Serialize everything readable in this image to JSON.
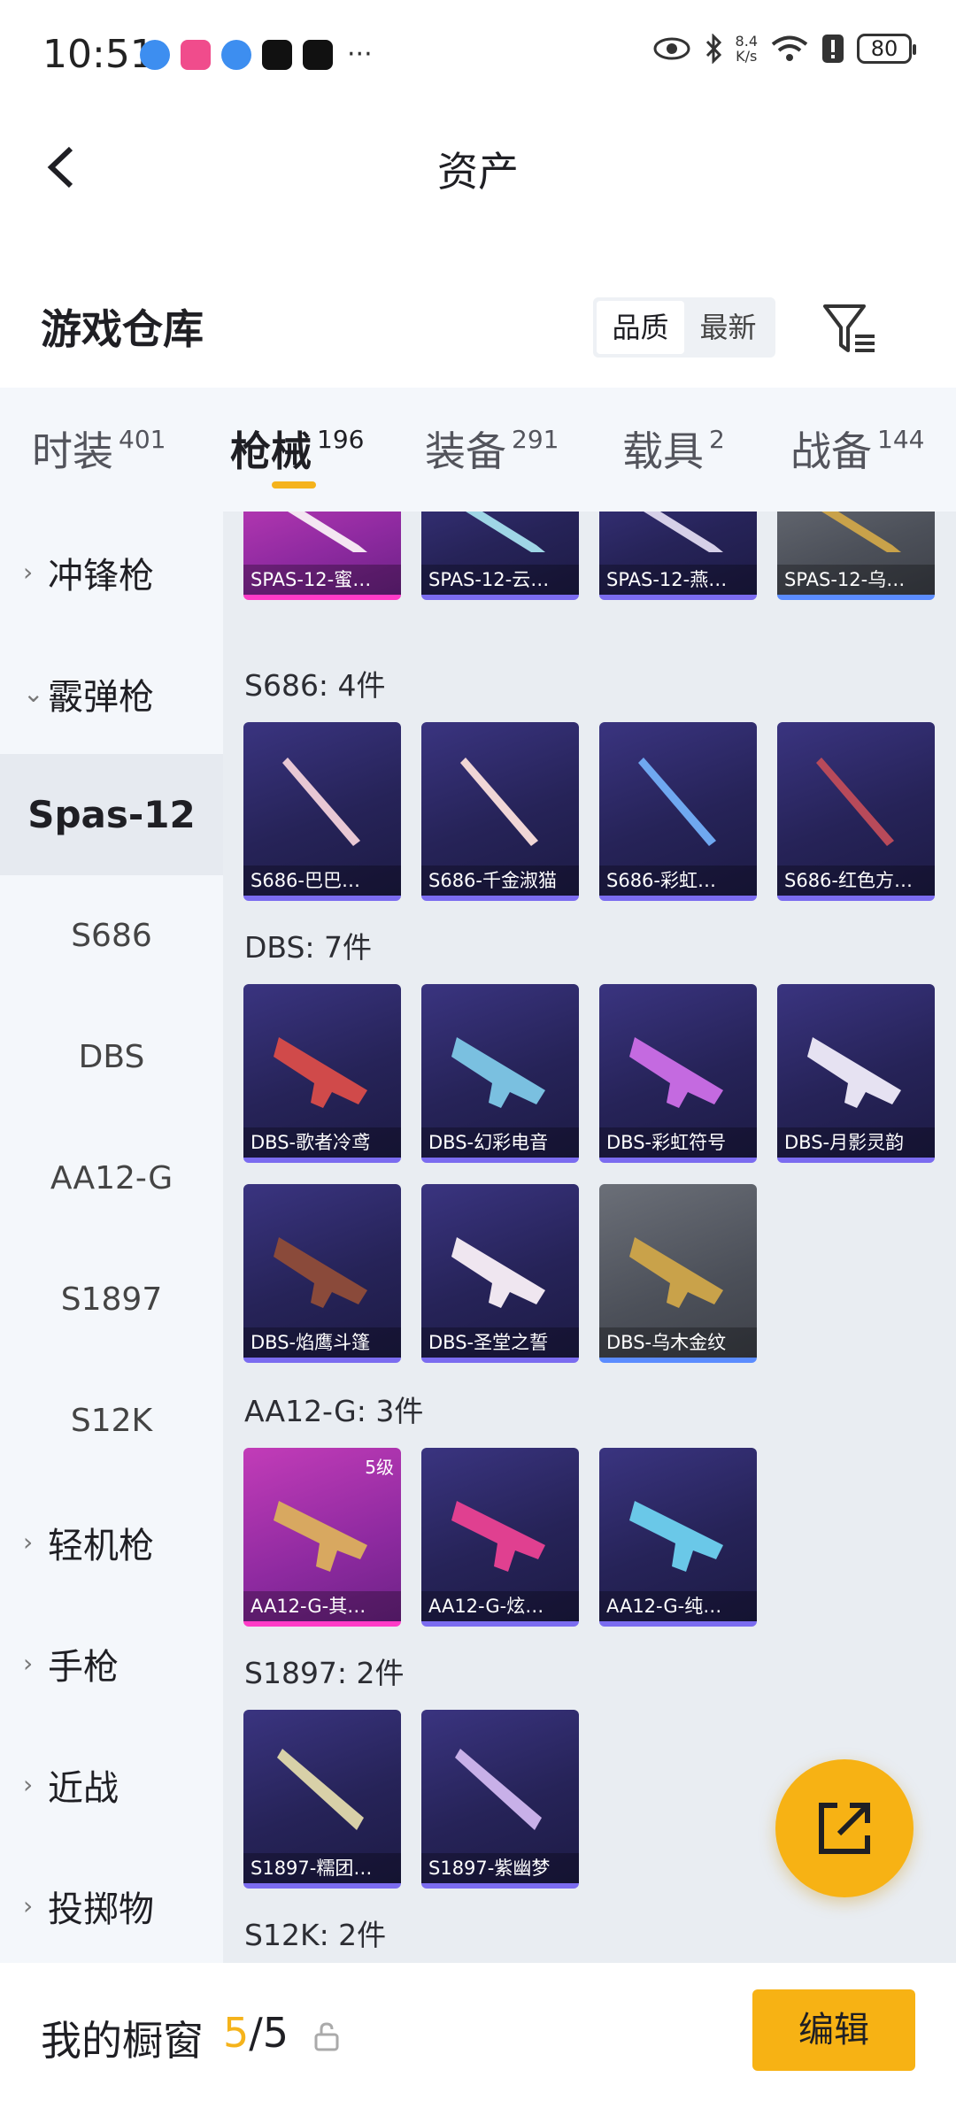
{
  "status_bar": {
    "time": "10:51",
    "overflow": "···",
    "net_speed_top": "8.4",
    "net_speed_bottom": "K/s",
    "battery": "80"
  },
  "header": {
    "title": "资产"
  },
  "section": {
    "title": "游戏仓库",
    "sort_options": [
      "品质",
      "最新"
    ],
    "sort_selected": "品质"
  },
  "tabs": [
    {
      "label": "时装",
      "count": "401"
    },
    {
      "label": "枪械",
      "count": "196"
    },
    {
      "label": "装备",
      "count": "291"
    },
    {
      "label": "载具",
      "count": "2"
    },
    {
      "label": "战备",
      "count": "144"
    }
  ],
  "sidebar": {
    "items": [
      {
        "label": "冲锋枪",
        "chevron": "›"
      },
      {
        "label": "霰弹枪",
        "chevron": "⌄"
      },
      {
        "label": "Spas-12"
      },
      {
        "label": "S686"
      },
      {
        "label": "DBS"
      },
      {
        "label": "AA12-G"
      },
      {
        "label": "S1897"
      },
      {
        "label": "S12K"
      },
      {
        "label": "轻机枪",
        "chevron": "›"
      },
      {
        "label": "手枪",
        "chevron": "›"
      },
      {
        "label": "近战",
        "chevron": "›"
      },
      {
        "label": "投掷物",
        "chevron": "›"
      }
    ]
  },
  "groups": {
    "spas": {
      "items": [
        "SPAS-12-蜜…",
        "SPAS-12-云…",
        "SPAS-12-燕…",
        "SPAS-12-乌…"
      ]
    },
    "s686": {
      "heading": "S686: 4件",
      "items": [
        "S686-巴巴…",
        "S686-千金淑猫",
        "S686-彩虹…",
        "S686-红色方…"
      ]
    },
    "dbs": {
      "heading": "DBS: 7件",
      "items": [
        "DBS-歌者冷鸢",
        "DBS-幻彩电音",
        "DBS-彩虹符号",
        "DBS-月影灵韵",
        "DBS-焰鹰斗篷",
        "DBS-圣堂之誓",
        "DBS-乌木金纹"
      ]
    },
    "aa12": {
      "heading": "AA12-G: 3件",
      "items": [
        "AA12-G-其…",
        "AA12-G-炫…",
        "AA12-G-纯…"
      ],
      "level_badge": "5级"
    },
    "s1897": {
      "heading": "S1897: 2件",
      "items": [
        "S1897-糯团…",
        "S1897-紫幽梦"
      ]
    },
    "s12k": {
      "heading": "S12K: 2件"
    }
  },
  "bottom_bar": {
    "label": "我的橱窗",
    "count_current": "5",
    "count_sep_total": "/5",
    "edit_label": "编辑"
  },
  "colors": {
    "accent": "#f7b214",
    "rarity_purple": "#7b6cf0",
    "rarity_pink": "#ff3bc7",
    "rarity_grey_bar": "#5b8cff"
  }
}
